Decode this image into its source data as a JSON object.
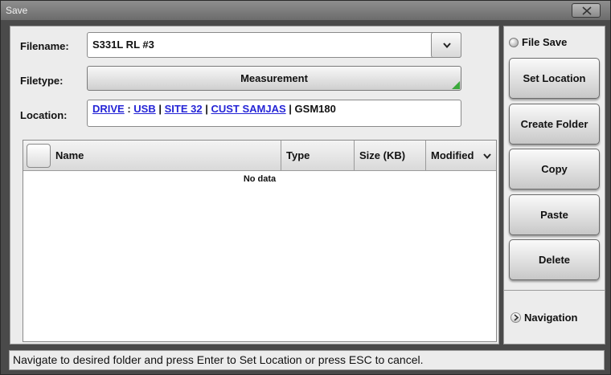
{
  "window": {
    "title": "Save"
  },
  "form": {
    "filename_label": "Filename:",
    "filename_value": "S331L RL #3",
    "filetype_label": "Filetype:",
    "filetype_value": "Measurement",
    "location_label": "Location:",
    "location_path": {
      "drive": "DRIVE",
      "sep1": " : ",
      "usb": "USB",
      "sep2": " | ",
      "site": "SITE 32",
      "sep3": " | ",
      "cust": "CUST SAMJAS",
      "sep4": " | ",
      "current": "GSM180"
    }
  },
  "table": {
    "columns": {
      "name": "Name",
      "type": "Type",
      "size": "Size (KB)",
      "modified": "Modified"
    },
    "empty_text": "No data"
  },
  "side": {
    "file_save_label": "File Save",
    "set_location": "Set Location",
    "create_folder": "Create Folder",
    "copy": "Copy",
    "paste": "Paste",
    "delete": "Delete",
    "navigation": "Navigation"
  },
  "status": {
    "text": "Navigate to desired folder and press Enter to Set Location or press ESC to cancel."
  },
  "icons": {
    "close": "close-icon",
    "dropdown": "chevron-down-icon",
    "navigation": "chevron-right-icon",
    "radio": "radio-icon"
  },
  "colors": {
    "link": "#2525d6",
    "corner_indicator": "#3aa83a"
  }
}
